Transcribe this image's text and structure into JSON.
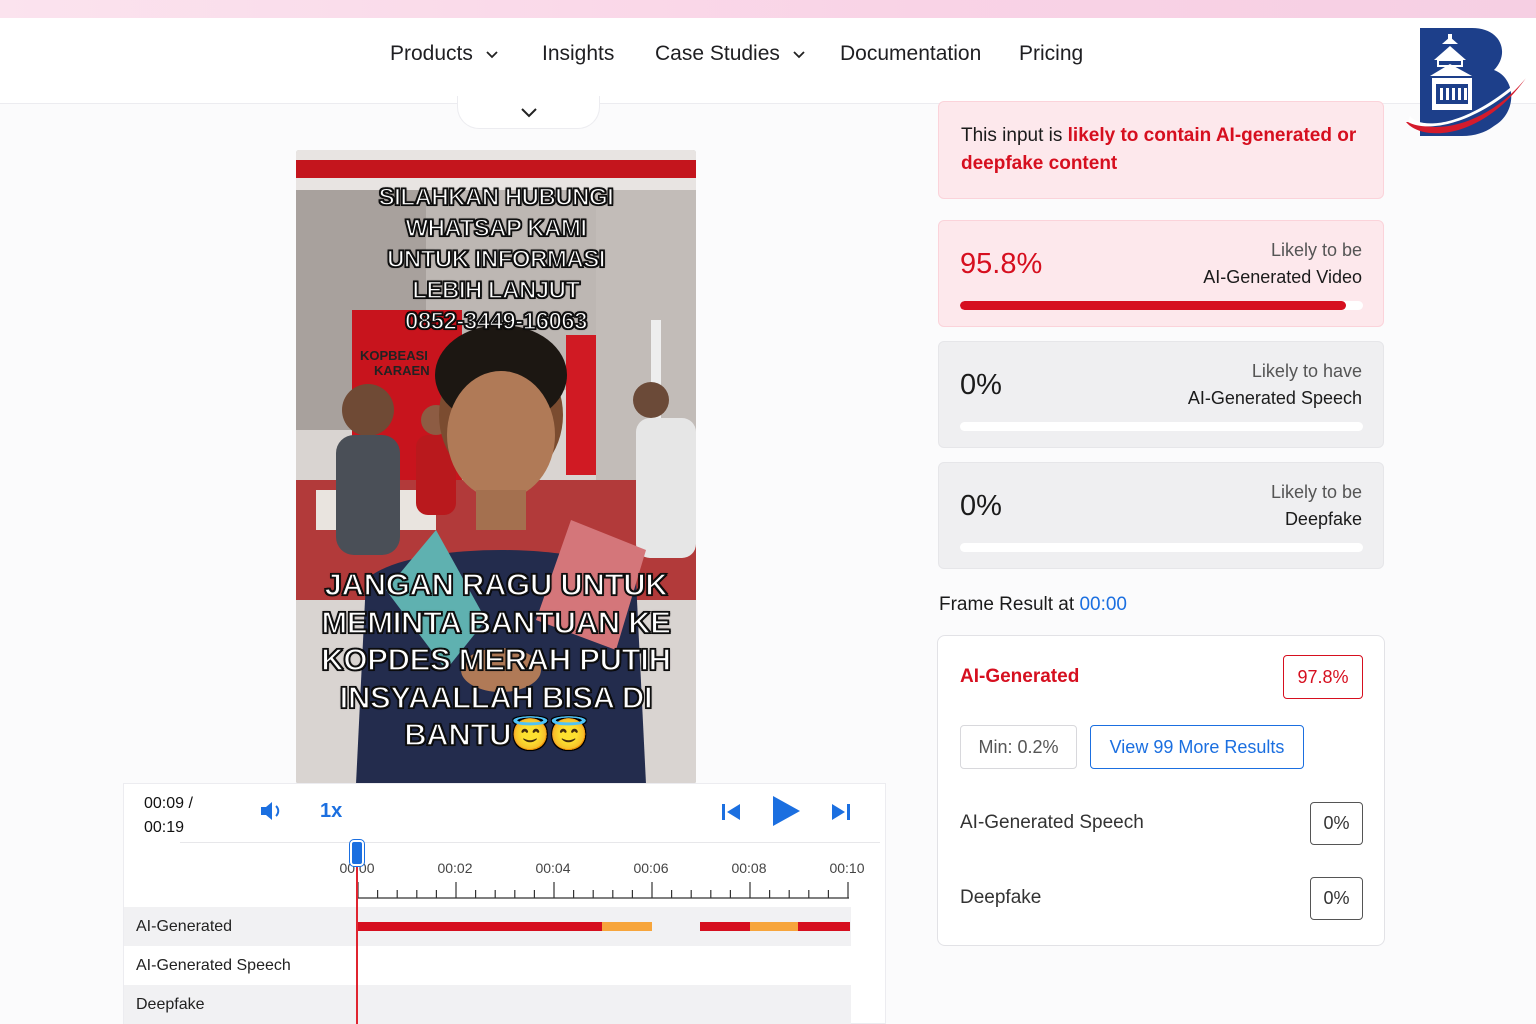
{
  "nav": {
    "products": "Products",
    "insights": "Insights",
    "case_studies": "Case Studies",
    "documentation": "Documentation",
    "pricing": "Pricing"
  },
  "video": {
    "top_caption_lines": [
      "SILAHKAN HUBUNGI",
      "WHATSAP KAMI",
      "UNTUK INFORMASI",
      "LEBIH LANJUT",
      "0852-3449-16063"
    ],
    "bottom_caption_lines": [
      "JANGAN RAGU UNTUK",
      "MEMINTA BANTUAN KE",
      "KOPDES MERAH PUTIH",
      "INSYAALLAH BISA DI",
      "BANTU😇😇"
    ],
    "sign_text": [
      "KOPBEASI",
      "KARAEN"
    ]
  },
  "player": {
    "current": "00:09 /",
    "duration": "00:19",
    "speed": "1x",
    "ticks": [
      "00:00",
      "00:02",
      "00:04",
      "00:06",
      "00:08",
      "00:10"
    ],
    "tracks": [
      "AI-Generated",
      "AI-Generated Speech",
      "Deepfake"
    ]
  },
  "summary": {
    "prefix": "This input is ",
    "highlight": "likely to contain AI-generated or deepfake content"
  },
  "cards": [
    {
      "pct": "95.8%",
      "fraction": 0.958,
      "line1": "Likely to be",
      "line2": "AI-Generated Video"
    },
    {
      "pct": "0%",
      "fraction": 0,
      "line1": "Likely to have",
      "line2": "AI-Generated Speech"
    },
    {
      "pct": "0%",
      "fraction": 0,
      "line1": "Likely to be",
      "line2": "Deepfake"
    }
  ],
  "frame": {
    "title": "Frame Result at ",
    "timestamp": "00:00",
    "ai_label": "AI-Generated",
    "ai_value": "97.8%",
    "min_label": "Min: 0.2%",
    "more_button": "View 99 More Results",
    "speech_label": "AI-Generated Speech",
    "speech_value": "0%",
    "deepfake_label": "Deepfake",
    "deepfake_value": "0%"
  },
  "colors": {
    "accent_red": "#d60f1f",
    "accent_blue": "#1b6fe0",
    "warn_orange": "#f7a53b"
  }
}
